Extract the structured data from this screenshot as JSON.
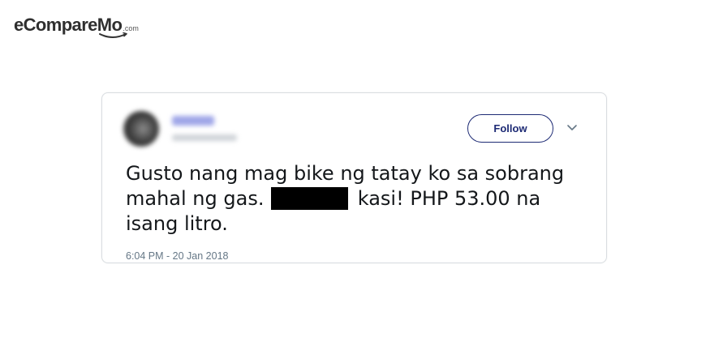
{
  "logo": {
    "main_text": "eCompareMo",
    "dotcom_text": ".com"
  },
  "tweet": {
    "follow_label": "Follow",
    "text_before": "Gusto nang mag bike ng tatay ko sa sobrang mahal ng gas.",
    "text_after": "kasi! PHP 53.00 na isang litro.",
    "timestamp": "6:04 PM - 20 Jan 2018"
  },
  "colors": {
    "follow_border": "#1d2a74",
    "text": "#14171a",
    "timestamp": "#657786",
    "card_border": "#d9dde1",
    "redaction": "#000000"
  },
  "icons": {
    "caret": "chevron-down-icon",
    "logo_smile": "smile-arc-icon"
  }
}
